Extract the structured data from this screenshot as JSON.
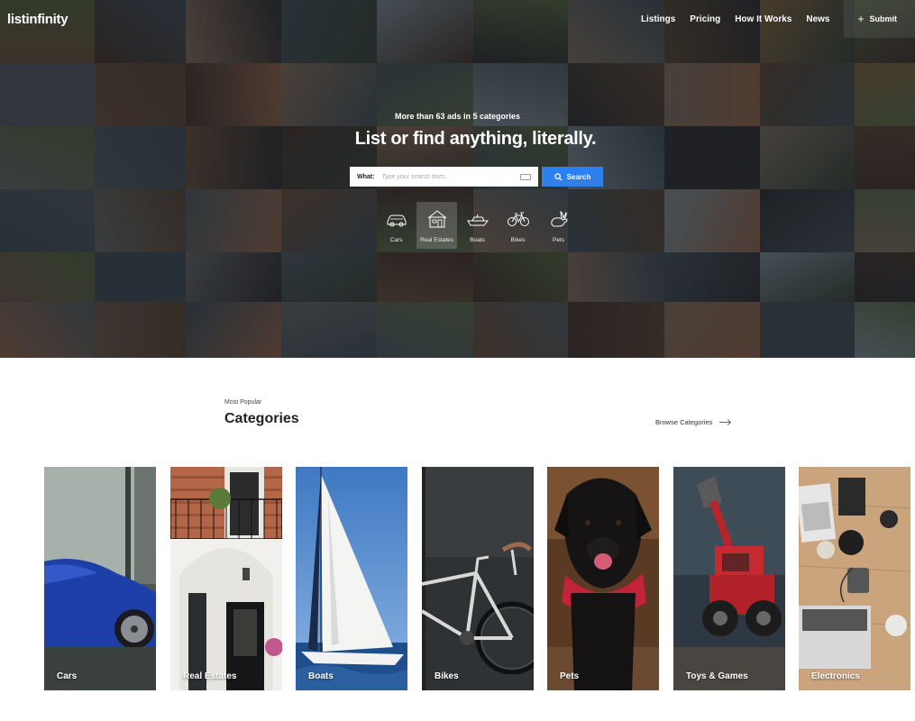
{
  "brand": {
    "logo": "listinfinity"
  },
  "nav": {
    "items": [
      "Listings",
      "Pricing",
      "How It Works",
      "News"
    ],
    "submit": "Submit"
  },
  "hero": {
    "subtitle": "More than 63 ads in 5 categories",
    "title": "List or find anything, literally.",
    "search_label": "What:",
    "search_placeholder": "Type your search term...",
    "search_button": "Search",
    "categories": [
      {
        "label": "Cars",
        "icon": "car-icon"
      },
      {
        "label": "Real Estates",
        "icon": "house-icon"
      },
      {
        "label": "Boats",
        "icon": "boat-icon"
      },
      {
        "label": "Bikes",
        "icon": "bike-icon"
      },
      {
        "label": "Pets",
        "icon": "rabbit-icon"
      }
    ]
  },
  "categories_section": {
    "eyebrow": "Most Popular",
    "title": "Categories",
    "browse": "Browse Categories",
    "cards": [
      "Cars",
      "Real Estates",
      "Boats",
      "Bikes",
      "Pets",
      "Toys & Games",
      "Electronics"
    ]
  },
  "colors": {
    "accent": "#2f80ed",
    "text": "#222222",
    "hero_overlay": "#0a0a0c"
  }
}
